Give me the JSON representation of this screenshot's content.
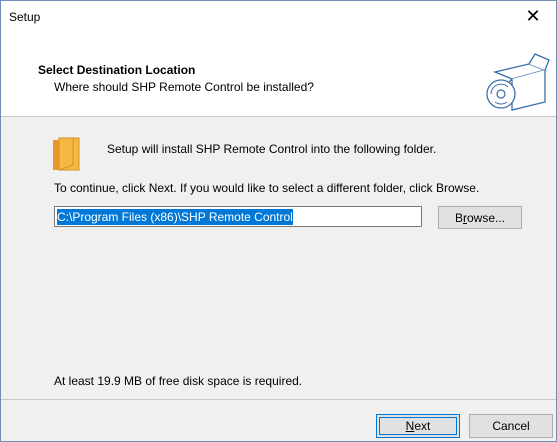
{
  "window": {
    "title": "Setup",
    "close_glyph": "✕"
  },
  "header": {
    "title": "Select Destination Location",
    "subtitle": "Where should SHP Remote Control be installed?",
    "logo_icon": "install-box-cd-icon"
  },
  "body": {
    "folder_icon": "folder-icon",
    "intro": "Setup will install SHP Remote Control into the following folder.",
    "continue_text": "To continue, click Next. If you would like to select a different folder, click Browse.",
    "path_value": "C:\\Program Files (x86)\\SHP Remote Control",
    "browse_prefix": "B",
    "browse_mnemonic": "r",
    "browse_suffix": "owse...",
    "disk_space": "At least 19.9 MB of free disk space is required."
  },
  "footer": {
    "next_mnemonic": "N",
    "next_suffix": "ext",
    "cancel_label": "Cancel"
  },
  "colors": {
    "selection": "#0078d7",
    "folder": "#f6b843"
  }
}
